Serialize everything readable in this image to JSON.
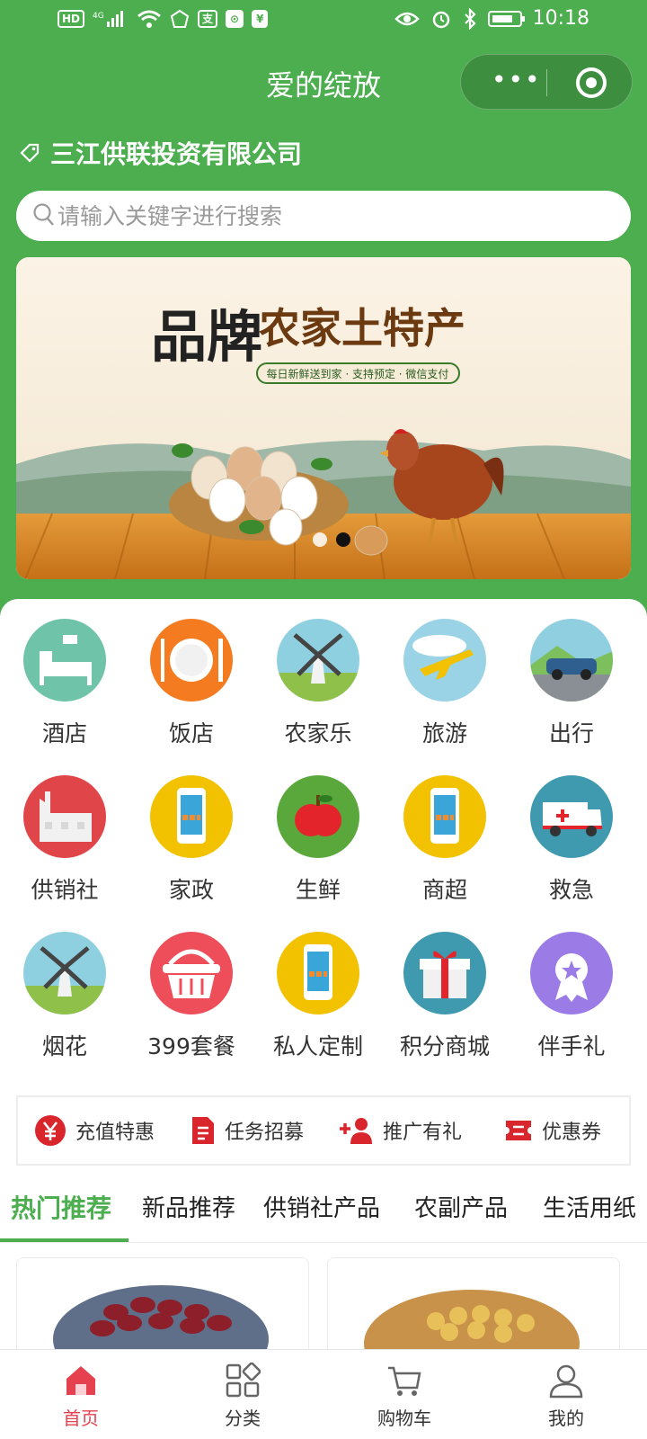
{
  "status_bar": {
    "left_chips": [
      "HD",
      "4G",
      "支",
      "⊙",
      "¥"
    ],
    "time": "10:18"
  },
  "nav": {
    "title": "爱的绽放"
  },
  "header": {
    "company": "三江供联投资有限公司"
  },
  "search": {
    "placeholder": "请输入关键字进行搜索"
  },
  "banner": {
    "headline": "品牌",
    "title": "农家土特产",
    "slogan": "每日新鲜送到家 · 支持预定 · 微信支付",
    "slides": 2,
    "active_slide": 2
  },
  "categories": [
    {
      "label": "酒店",
      "icon": "hotel-bed-icon",
      "color": "#6fc3a8"
    },
    {
      "label": "饭店",
      "icon": "plate-fork-knife-icon",
      "color": "#f47b20"
    },
    {
      "label": "农家乐",
      "icon": "windmill-icon",
      "color": "#8fd0e0"
    },
    {
      "label": "旅游",
      "icon": "airplane-icon",
      "color": "#9ad2e6"
    },
    {
      "label": "出行",
      "icon": "car-icon",
      "color": "#8fcfe0"
    },
    {
      "label": "供销社",
      "icon": "factory-icon",
      "color": "#e0454a"
    },
    {
      "label": "家政",
      "icon": "phone-icon",
      "color": "#f2c200"
    },
    {
      "label": "生鲜",
      "icon": "apple-icon",
      "color": "#5aa83c"
    },
    {
      "label": "商超",
      "icon": "phone-icon",
      "color": "#f2c200"
    },
    {
      "label": "救急",
      "icon": "ambulance-icon",
      "color": "#3f9ab0"
    },
    {
      "label": "烟花",
      "icon": "windmill-icon",
      "color": "#8fd0e0"
    },
    {
      "label": "399套餐",
      "icon": "basket-icon",
      "color": "#ee4d5a"
    },
    {
      "label": "私人定制",
      "icon": "phone-icon",
      "color": "#f2c200"
    },
    {
      "label": "积分商城",
      "icon": "gift-icon",
      "color": "#3f9ab0"
    },
    {
      "label": "伴手礼",
      "icon": "medal-icon",
      "color": "#9b7be6"
    }
  ],
  "quick_links": [
    {
      "label": "充值特惠",
      "icon": "yen-circle-icon"
    },
    {
      "label": "任务招募",
      "icon": "document-icon"
    },
    {
      "label": "推广有礼",
      "icon": "add-user-icon"
    },
    {
      "label": "优惠券",
      "icon": "coupon-icon"
    }
  ],
  "tabs": [
    {
      "label": "热门推荐",
      "active": true
    },
    {
      "label": "新品推荐",
      "active": false
    },
    {
      "label": "供销社产品",
      "active": false
    },
    {
      "label": "农副产品",
      "active": false
    },
    {
      "label": "生活用纸",
      "active": false
    }
  ],
  "tab_bar": [
    {
      "label": "首页",
      "icon": "home-icon",
      "active": true
    },
    {
      "label": "分类",
      "icon": "category-grid-icon",
      "active": false
    },
    {
      "label": "购物车",
      "icon": "cart-icon",
      "active": false
    },
    {
      "label": "我的",
      "icon": "user-icon",
      "active": false
    }
  ],
  "colors": {
    "brand_green": "#4cae4f",
    "active_red": "#e5414f",
    "quick_red": "#d9262c"
  }
}
